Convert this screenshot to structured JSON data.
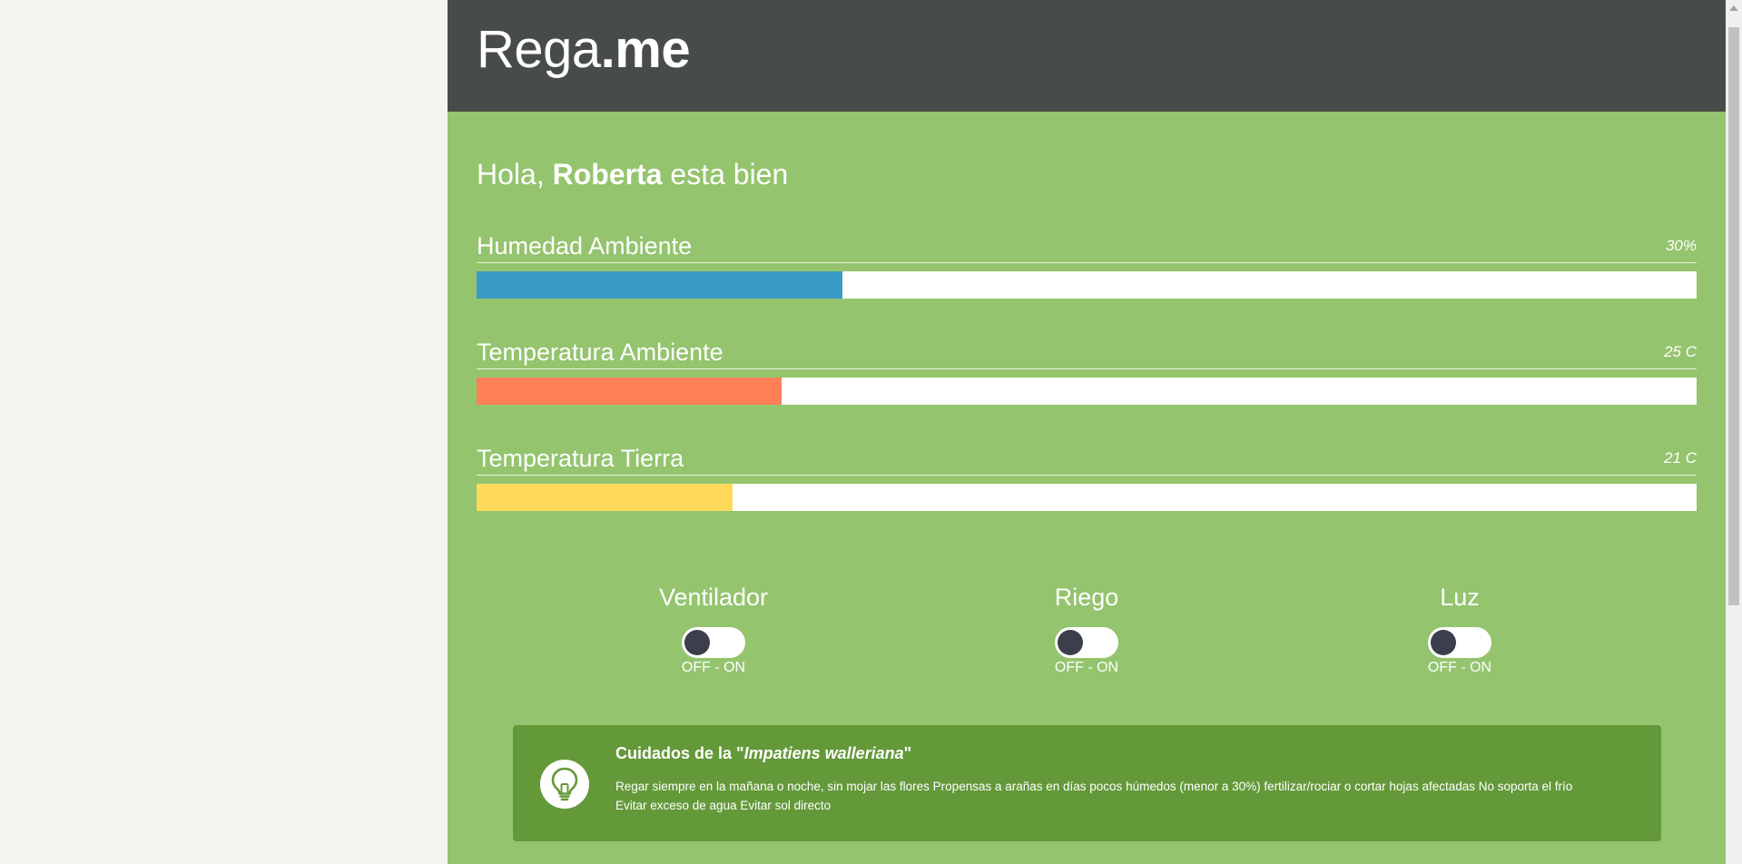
{
  "header": {
    "brand_prefix": "Rega",
    "brand_suffix": ".me"
  },
  "greeting": {
    "prefix": "Hola,",
    "name": "Roberta",
    "suffix": "esta bien"
  },
  "metrics": [
    {
      "label": "Humedad Ambiente",
      "value": "30%",
      "level": 0.3,
      "color": "#3a9ac6"
    },
    {
      "label": "Temperatura Ambiente",
      "value": "25 C",
      "level": 0.25,
      "color": "#ff7f57"
    },
    {
      "label": "Temperatura Tierra",
      "value": "21 C",
      "level": 0.21,
      "color": "#ffd95c"
    }
  ],
  "toggles": [
    {
      "label": "Ventilador",
      "state_label": "OFF - ON",
      "on": false
    },
    {
      "label": "Riego",
      "state_label": "OFF - ON",
      "on": false
    },
    {
      "label": "Luz",
      "state_label": "OFF - ON",
      "on": false
    }
  ],
  "tip": {
    "icon": "lightbulb-icon",
    "title_prefix": "Cuidados de la \"",
    "title_species": "Impatiens walleriana",
    "title_suffix": "\"",
    "body": "Regar siempre en la mañana o noche, sin mojar las flores Propensas a arañas en días pocos húmedos (menor a 30%) fertilizar/rociar o cortar hojas afectadas No soporta el frío Evitar exceso de agua Evitar sol directo"
  },
  "colors": {
    "header_bg": "#484c49",
    "content_bg": "#94c46e",
    "tip_bg": "#64993a",
    "knob": "#3b3f4c"
  }
}
